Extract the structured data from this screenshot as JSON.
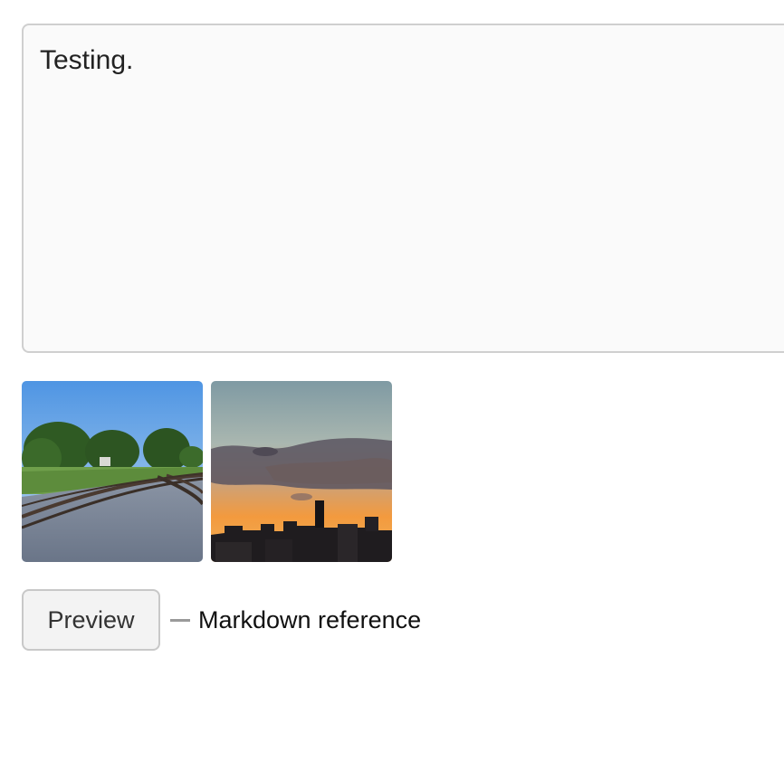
{
  "editor": {
    "value": "Testing."
  },
  "attachments": [
    {
      "icon": "railroad-tracks-photo"
    },
    {
      "icon": "city-skyline-sunset-photo"
    }
  ],
  "actions": {
    "preview_label": "Preview",
    "markdown_link": "Markdown reference"
  },
  "colors": {
    "editor_bg": "#fafafa",
    "editor_border": "#cfcfcf",
    "button_bg": "#f3f3f3",
    "button_border": "#c8c8c8",
    "separator": "#9a9a9a"
  }
}
